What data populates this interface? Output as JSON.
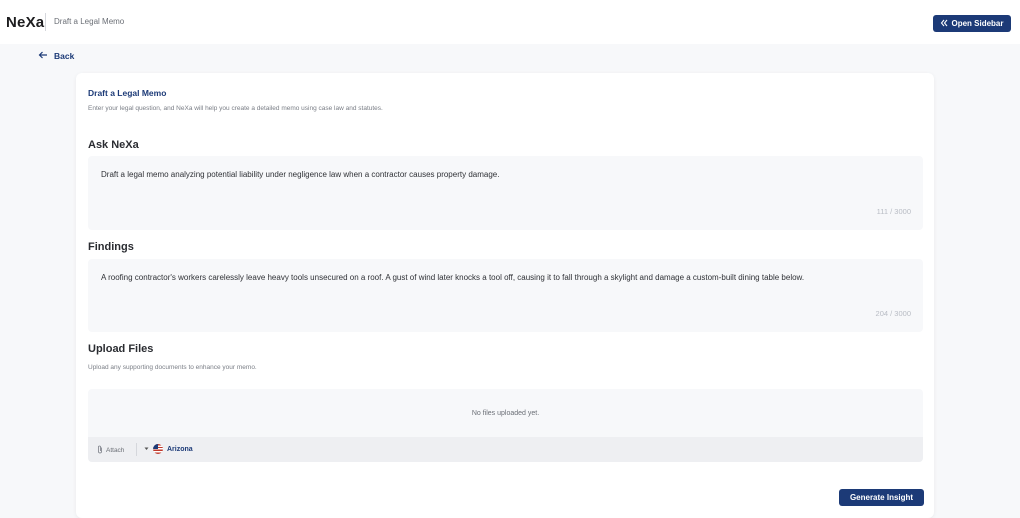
{
  "header": {
    "brand": "NeXa",
    "breadcrumb": "Draft a Legal Memo",
    "open_sidebar_label": "Open Sidebar"
  },
  "nav": {
    "back_label": "Back"
  },
  "card": {
    "title": "Draft a Legal Memo",
    "subtitle": "Enter your legal question, and NeXa will help you create a detailed memo using case law and statutes."
  },
  "ask": {
    "label": "Ask NeXa",
    "value": "Draft a legal memo analyzing potential liability under negligence law when a contractor causes property damage.",
    "counter": "111 / 3000"
  },
  "findings": {
    "label": "Findings",
    "value": "A roofing contractor's workers carelessly leave heavy tools unsecured on a roof. A gust of wind later knocks a tool off, causing it to fall through a skylight and damage a custom-built dining table below.",
    "counter": "204 / 3000"
  },
  "upload": {
    "label": "Upload Files",
    "subtitle": "Upload any supporting documents to enhance your memo.",
    "empty_text": "No files uploaded yet.",
    "attach_label": "Attach",
    "jurisdiction": "Arizona"
  },
  "actions": {
    "generate_label": "Generate Insight"
  },
  "colors": {
    "primary": "#1c3a77",
    "field_bg": "#f7f8fa"
  }
}
